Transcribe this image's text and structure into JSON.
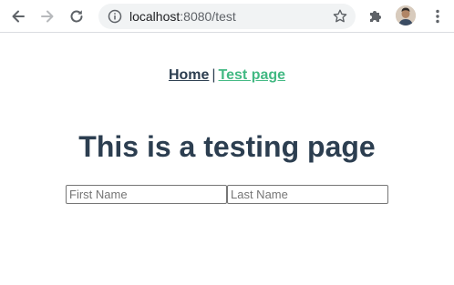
{
  "browser": {
    "url_host": "localhost",
    "url_rest": ":8080/test",
    "icons": {
      "back": "arrow-left-icon",
      "forward": "arrow-right-icon",
      "reload": "reload-icon",
      "site_info": "info-icon",
      "bookmark": "star-icon",
      "extensions": "puzzle-icon",
      "profile": "avatar",
      "menu": "kebab-menu-icon"
    }
  },
  "nav": {
    "home_label": "Home",
    "separator": "|",
    "test_label": "Test page"
  },
  "main": {
    "heading": "This is a testing page",
    "first_name_placeholder": "First Name",
    "last_name_placeholder": "Last Name"
  },
  "colors": {
    "text_dark": "#2c3e50",
    "link_green": "#42b983",
    "omnibox_bg": "#f1f3f4"
  }
}
